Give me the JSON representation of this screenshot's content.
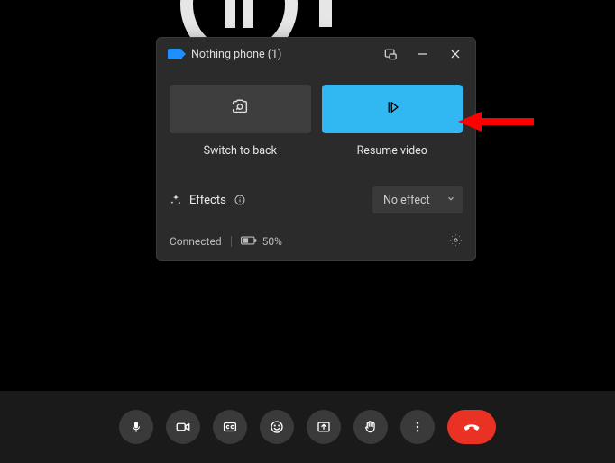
{
  "popup": {
    "title": "Nothing phone (1)",
    "switch_label": "Switch to back",
    "resume_label": "Resume video",
    "effects_label": "Effects",
    "effect_selected": "No effect"
  },
  "status": {
    "connected_label": "Connected",
    "battery_pct": "50%"
  },
  "colors": {
    "accent": "#31b7f2",
    "danger": "#e93224"
  },
  "icons": {
    "camera": "camera",
    "popout": "popout",
    "minimize": "minimize",
    "close": "close",
    "switch_camera": "switch-camera",
    "resume_play": "resume-play",
    "sparkle": "sparkle",
    "info": "info",
    "chevron_down": "chevron-down",
    "battery": "battery",
    "gear": "gear",
    "mic": "mic",
    "video": "video",
    "cc": "cc",
    "emoji": "emoji",
    "share": "share",
    "raise_hand": "raise-hand",
    "more": "more",
    "hangup": "hangup"
  }
}
